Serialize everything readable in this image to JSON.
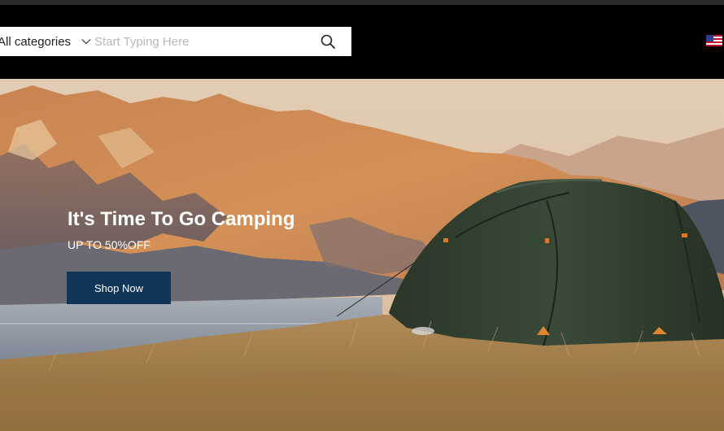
{
  "search": {
    "category_label": "All categories",
    "placeholder": "Start Typing Here",
    "value": ""
  },
  "locale": {
    "flag_icon": "us-flag-icon"
  },
  "hero": {
    "title": "It's Time To Go Camping",
    "subtitle": "UP TO 50%OFF",
    "cta_label": "Shop Now"
  },
  "colors": {
    "header_bg": "#000000",
    "cta_bg": "#0f3558",
    "tent": "#2e3a2c"
  }
}
